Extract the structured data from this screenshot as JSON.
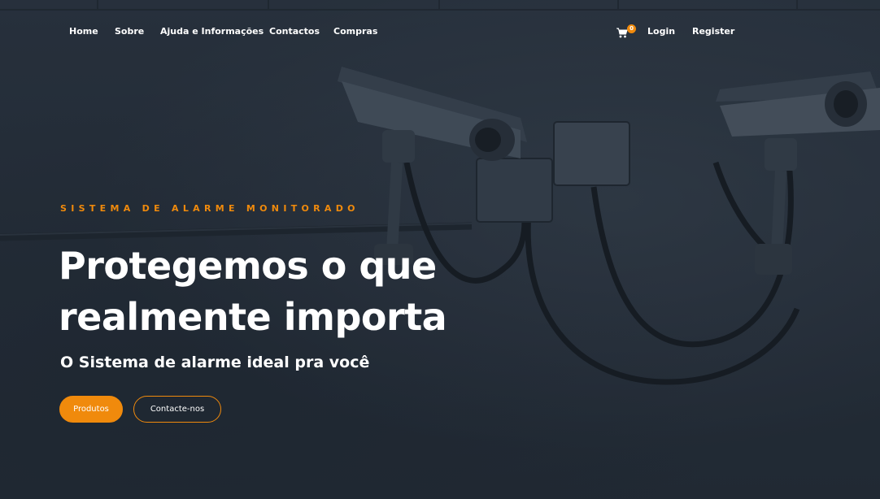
{
  "nav": {
    "items": [
      {
        "label": "Home"
      },
      {
        "label": "Sobre"
      },
      {
        "label": "Ajuda e Informações"
      },
      {
        "label": "Contactos"
      },
      {
        "label": "Compras"
      }
    ],
    "cart": {
      "count": "0",
      "icon": "shopping-cart-icon"
    },
    "login_label": "Login",
    "register_label": "Register"
  },
  "hero": {
    "eyebrow": "SISTEMA DE ALARME MONITORADO",
    "headline_line1": "Protegemos o que",
    "headline_line2": "realmente importa",
    "subheading": "O Sistema de alarme ideal pra você",
    "primary_button": "Produtos",
    "secondary_button": "Contacte-nos"
  },
  "colors": {
    "accent": "#f08a0c",
    "overlay": "#262f3b",
    "text": "#ffffff"
  }
}
